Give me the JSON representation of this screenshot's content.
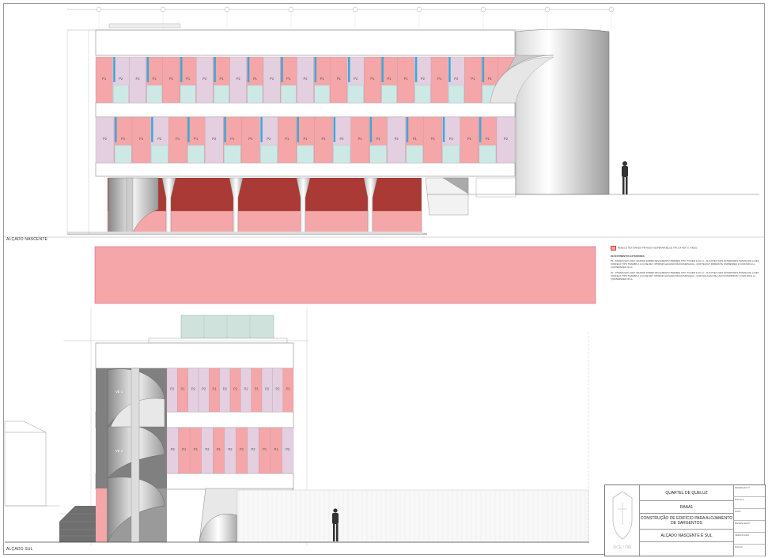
{
  "labels": {
    "north_view": "ALÇADO NASCENTE",
    "south_view": "ALÇADO SUL"
  },
  "legend": {
    "swatch_text": "REBOCO TEXTURADO PINTADO A ESPERAM BEJ.EI TIPO 24 REF. D. 4006/2",
    "heading": "REVESTIMENTOS EXTERIORES",
    "p1_text": "P1 - PAINEIS EM LAJEO GRANDE DOBRE REVLEMENTO PERMEIS TIPO 'TOLIER' E 40 cm - ALICOTECI MAS EXTERIORES TRAMAS DE LAJEC CONFECC TIPO TRAMBS 3 1.0.0 DE DET. OPOPAM GALVANO PACIVA METALICA - COR TECULT PAREMCTE OSPRESSES 4 CO20.520 E LL: 'QUATERNOEN' ID LL",
    "p2_text": "P2 - PAINEIS EM LAJEO GRANDE DOBRE REVLEMENTO PERMEIS TIPO 'TOLIER' E 40 cm - ALICOTECI MAS EXTERIORES TRAMAS DE LAJEC CONFECC TIPO TRAMBS 3 1.0.0 DE DET. OPOPAM GALVANO PACIVA METALICA - COR ISOLAÇÃO DE LAÇOS DISPRIDOS 4 CO20.520 E LL: 'QUATERNOEN' ID LL"
  },
  "titleblock": {
    "logo_text": "RCE / DIE",
    "project": "QUARTEL DE QUELUZ",
    "unit": "RAAA1",
    "description": "CONSTRUÇÃO DE EDIFÍCIO PARA ALOJAMENTO DE SARGENTOS",
    "drawing": "ALÇADO NASCENTE E SUL",
    "right_cells": [
      "DESENHO Nº",
      "ESCALA",
      "DATA",
      "DESENHADO",
      "VERIFICADO",
      "FOLHA"
    ]
  },
  "north_panels_upper": [
    "P1",
    "P2",
    "P2",
    "P1",
    "P1",
    "P1",
    "P2",
    "P1",
    "P2",
    "P1",
    "P2",
    "P1",
    "P2",
    "P1",
    "P1",
    "P2",
    "P1",
    "P1",
    "P1",
    "P2",
    "P1",
    "P2",
    "P1",
    "P1",
    "P1"
  ],
  "north_panels_lower": [
    "P2",
    "P1",
    "P1",
    "P2",
    "P1",
    "P1",
    "P2",
    "P1",
    "P1",
    "P2",
    "P1",
    "P1",
    "P1",
    "P2",
    "P1",
    "P1",
    "P2",
    "P1",
    "P1",
    "P2",
    "P1",
    "P1",
    "P2"
  ],
  "south_panels_upper": [
    "P2",
    "P1",
    "P2",
    "P2",
    "P1",
    "P2",
    "P1",
    "P2",
    "P1",
    "P2",
    "P2",
    "P1"
  ],
  "south_panels_lower": [
    "P2",
    "P1",
    "P1",
    "P2",
    "P1",
    "P2",
    "P1",
    "P2",
    "P1",
    "P1",
    "P2"
  ],
  "stair_labels": [
    "VE 1",
    "VE 1"
  ],
  "colors": {
    "pink": "#f4a6a8",
    "lilac": "#e3cfe0",
    "blue": "#3fa7d6",
    "glass": "#cde9e6",
    "brick": "#a93a35",
    "grey": "#d9d9d9"
  }
}
